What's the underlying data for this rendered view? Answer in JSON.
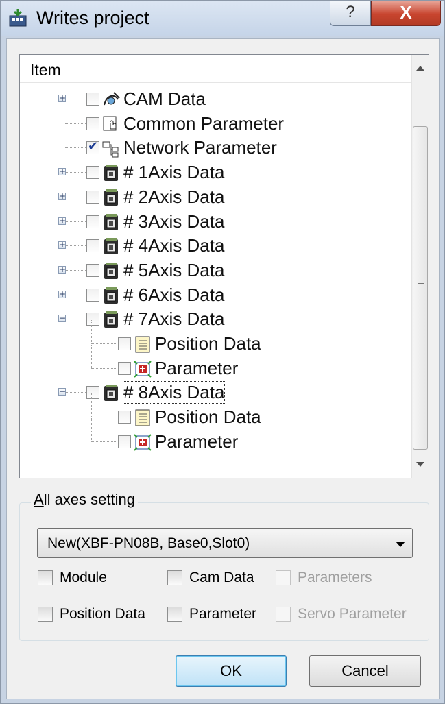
{
  "window": {
    "title": "Writes project",
    "help_label": "?",
    "close_label": "X"
  },
  "tree": {
    "header": "Item",
    "rows": [
      {
        "label": "CAM Data",
        "checked": false,
        "expander": "+",
        "icon": "cam-data-icon"
      },
      {
        "label": "Common Parameter",
        "checked": false,
        "expander": "",
        "icon": "common-parameter-icon"
      },
      {
        "label": "Network Parameter",
        "checked": true,
        "expander": "",
        "icon": "network-parameter-icon"
      },
      {
        "label": "# 1Axis Data",
        "checked": false,
        "expander": "+",
        "icon": "axis-data-icon"
      },
      {
        "label": "# 2Axis Data",
        "checked": false,
        "expander": "+",
        "icon": "axis-data-icon"
      },
      {
        "label": "# 3Axis Data",
        "checked": false,
        "expander": "+",
        "icon": "axis-data-icon"
      },
      {
        "label": "# 4Axis Data",
        "checked": false,
        "expander": "+",
        "icon": "axis-data-icon"
      },
      {
        "label": "# 5Axis Data",
        "checked": false,
        "expander": "+",
        "icon": "axis-data-icon"
      },
      {
        "label": "# 6Axis Data",
        "checked": false,
        "expander": "+",
        "icon": "axis-data-icon"
      },
      {
        "label": "# 7Axis Data",
        "checked": false,
        "expander": "-",
        "icon": "axis-data-icon"
      },
      {
        "label": "Position Data",
        "checked": false,
        "expander": "",
        "icon": "position-data-icon"
      },
      {
        "label": "Parameter",
        "checked": false,
        "expander": "",
        "icon": "parameter-icon"
      },
      {
        "label": "# 8Axis Data",
        "checked": false,
        "expander": "-",
        "icon": "axis-data-icon"
      },
      {
        "label": "Position Data",
        "checked": false,
        "expander": "",
        "icon": "position-data-icon"
      },
      {
        "label": "Parameter",
        "checked": false,
        "expander": "",
        "icon": "parameter-icon"
      }
    ]
  },
  "all_axes": {
    "title": "All axes setting",
    "title_accel_underline": "A",
    "title_rest": "ll axes setting",
    "combo_value": "New(XBF-PN08B, Base0,Slot0)",
    "options": {
      "module": "Module",
      "cam_data": "Cam Data",
      "parameters": "Parameters",
      "position_data": "Position Data",
      "parameter": "Parameter",
      "servo_parameter": "Servo Parameter"
    }
  },
  "buttons": {
    "ok": "OK",
    "cancel": "Cancel"
  },
  "colors": {
    "check": "#1c3c93",
    "titlebar": "#c5d4e8",
    "close": "#c8452f"
  }
}
